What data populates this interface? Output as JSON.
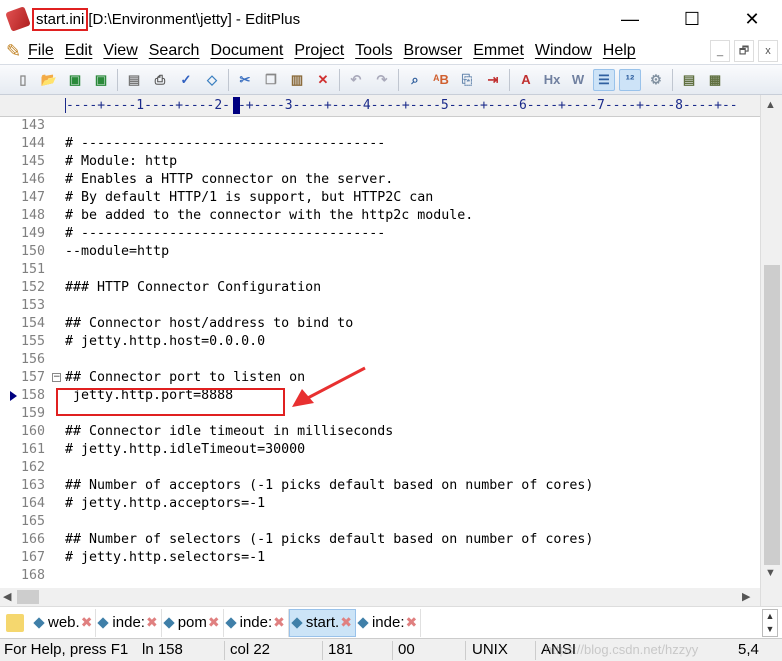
{
  "window": {
    "filename": "start.ini",
    "title_rest": " [D:\\Environment\\jetty] - EditPlus",
    "minimize": "—",
    "maximize": "☐",
    "close": "✕"
  },
  "menu": [
    "File",
    "Edit",
    "View",
    "Search",
    "Document",
    "Project",
    "Tools",
    "Browser",
    "Emmet",
    "Window",
    "Help"
  ],
  "mdi": {
    "minimize": "_",
    "restore": "🗗",
    "close": "x"
  },
  "toolbar": [
    "new-file",
    "open",
    "save",
    "save-all",
    "print-preview",
    "print",
    "spell-check",
    "browser-preview",
    "cut",
    "copy",
    "paste",
    "delete",
    "undo",
    "redo",
    "find",
    "replace",
    "goto",
    "indent",
    "font",
    "hx",
    "word-wrap",
    "line-number",
    "column-select",
    "settings",
    "cliptext",
    "directory"
  ],
  "ruler": "----+----1----+----2-",
  "ruler2": "-+----3----+----4----+----5----+----6----+----7----+----8----+--",
  "editor": {
    "lines": [
      {
        "n": "143",
        "t": ""
      },
      {
        "n": "144",
        "t": "# --------------------------------------"
      },
      {
        "n": "145",
        "t": "# Module: http"
      },
      {
        "n": "146",
        "t": "# Enables a HTTP connector on the server."
      },
      {
        "n": "147",
        "t": "# By default HTTP/1 is support, but HTTP2C can"
      },
      {
        "n": "148",
        "t": "# be added to the connector with the http2c module."
      },
      {
        "n": "149",
        "t": "# --------------------------------------"
      },
      {
        "n": "150",
        "t": "--module=http"
      },
      {
        "n": "151",
        "t": ""
      },
      {
        "n": "152",
        "t": "### HTTP Connector Configuration"
      },
      {
        "n": "153",
        "t": ""
      },
      {
        "n": "154",
        "t": "## Connector host/address to bind to"
      },
      {
        "n": "155",
        "t": "# jetty.http.host=0.0.0.0"
      },
      {
        "n": "156",
        "t": ""
      },
      {
        "n": "157",
        "t": "## Connector port to listen on"
      },
      {
        "n": "158",
        "t": " jetty.http.port=8888"
      },
      {
        "n": "159",
        "t": ""
      },
      {
        "n": "160",
        "t": "## Connector idle timeout in milliseconds"
      },
      {
        "n": "161",
        "t": "# jetty.http.idleTimeout=30000"
      },
      {
        "n": "162",
        "t": ""
      },
      {
        "n": "163",
        "t": "## Number of acceptors (-1 picks default based on number of cores)"
      },
      {
        "n": "164",
        "t": "# jetty.http.acceptors=-1"
      },
      {
        "n": "165",
        "t": ""
      },
      {
        "n": "166",
        "t": "## Number of selectors (-1 picks default based on number of cores)"
      },
      {
        "n": "167",
        "t": "# jetty.http.selectors=-1"
      },
      {
        "n": "168",
        "t": ""
      }
    ],
    "current_line": "158",
    "fold_line": "157"
  },
  "tabs": [
    {
      "label": "web.",
      "active": false
    },
    {
      "label": "inde:",
      "active": false
    },
    {
      "label": "pom",
      "active": false
    },
    {
      "label": "inde:",
      "active": false
    },
    {
      "label": "start.",
      "active": true
    },
    {
      "label": "inde:",
      "active": false
    }
  ],
  "status": {
    "help": "For Help, press F1",
    "ln": "ln 158",
    "col": "col 22",
    "chars": "181",
    "code": "00",
    "eol": "UNIX",
    "encoding": "ANSI",
    "extra": "5,4"
  },
  "watermark": "https://blog.csdn.net/hzzyy",
  "colors": {
    "highlight": "#e02020",
    "line_numbers": "#808080",
    "ruler": "#1a2a8a",
    "active_tab": "#cce4f7"
  }
}
